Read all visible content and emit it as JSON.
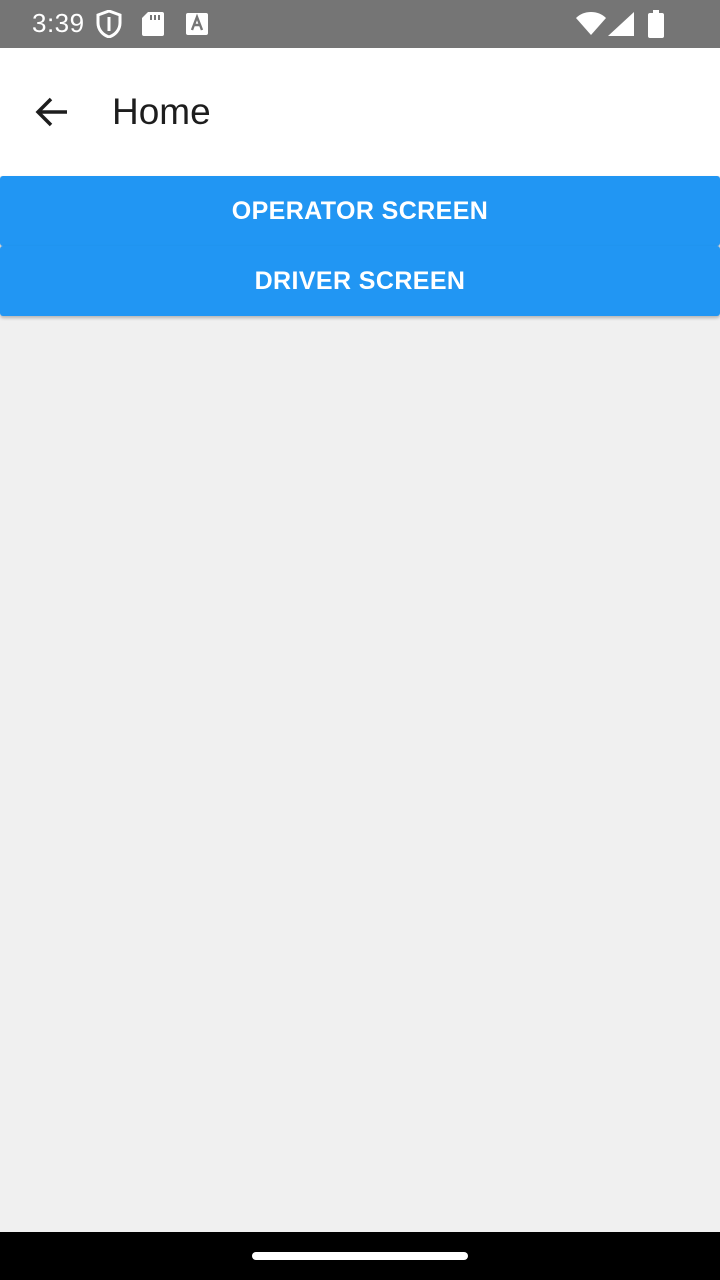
{
  "status_bar": {
    "time": "3:39",
    "icons": [
      "shield-icon",
      "sd-card-icon",
      "font-a-icon",
      "wifi-icon",
      "signal-icon",
      "battery-icon"
    ]
  },
  "app_bar": {
    "title": "Home",
    "back_icon": "arrow-back-icon"
  },
  "buttons": {
    "operator": "OPERATOR SCREEN",
    "driver": "DRIVER SCREEN"
  },
  "colors": {
    "status_bar": "#757575",
    "primary_button": "#2196f3",
    "background": "#f0f0f0",
    "nav_bar": "#000000"
  }
}
